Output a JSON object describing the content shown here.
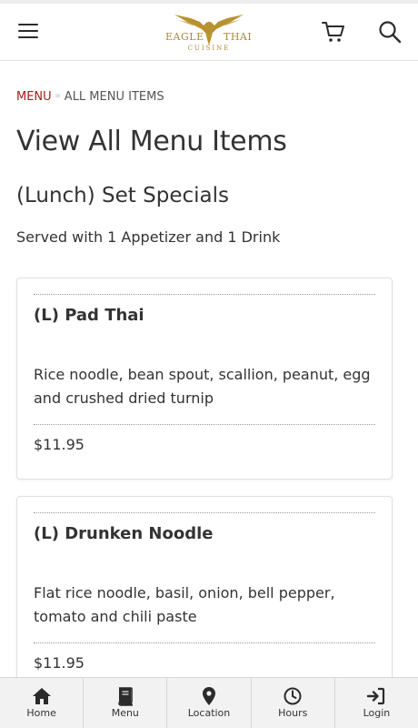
{
  "header": {
    "menu_icon": "hamburger-menu-icon",
    "logo": {
      "word_left": "EAGLE",
      "word_right": "THAI",
      "subtitle": "CUISINE",
      "color": "#b08d3a"
    },
    "cart_icon": "shopping-cart-icon",
    "search_icon": "search-icon"
  },
  "breadcrumb": {
    "link": "MENU",
    "separator": "»",
    "current": "ALL MENU ITEMS",
    "link_color": "#a81c1c"
  },
  "page": {
    "title": "View All Menu Items"
  },
  "section": {
    "title": "(Lunch) Set Specials",
    "description": "Served with 1 Appetizer and 1 Drink"
  },
  "items": [
    {
      "name": "(L) Pad Thai",
      "description": "Rice noodle, bean spout, scallion, peanut, egg and crushed dried turnip",
      "price": "$11.95"
    },
    {
      "name": "(L) Drunken Noodle",
      "description": "Flat rice noodle, basil, onion, bell pepper, tomato and chili paste",
      "price": "$11.95"
    }
  ],
  "bottom_nav": [
    {
      "label": "Home",
      "icon": "home-icon"
    },
    {
      "label": "Menu",
      "icon": "book-icon"
    },
    {
      "label": "Location",
      "icon": "map-pin-icon"
    },
    {
      "label": "Hours",
      "icon": "clock-icon"
    },
    {
      "label": "Login",
      "icon": "sign-in-icon"
    }
  ]
}
